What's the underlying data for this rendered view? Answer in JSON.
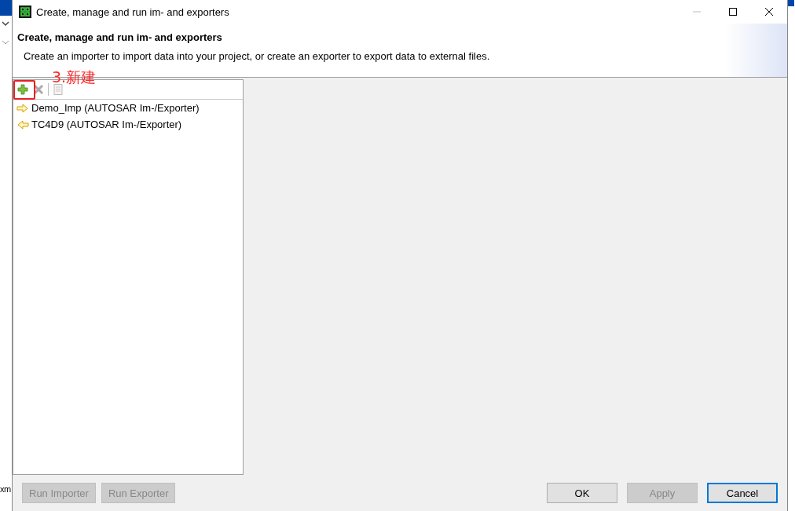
{
  "background": {
    "fragment": "xm"
  },
  "window": {
    "title": "Create, manage and run im- and exporters"
  },
  "header": {
    "title": "Create, manage and run im- and exporters",
    "description": "Create an importer to import data into your project, or create an exporter to export data to external files."
  },
  "toolbar": [
    {
      "kind": "add",
      "disabled": false,
      "highlighted": true
    },
    {
      "kind": "delete",
      "disabled": true,
      "highlighted": false
    },
    {
      "kind": "copy",
      "disabled": true,
      "highlighted": false
    }
  ],
  "annotation": {
    "text": "3.新建"
  },
  "list": [
    {
      "kind": "outgoing",
      "label": "Demo_Imp (AUTOSAR Im-/Exporter)"
    },
    {
      "kind": "incoming",
      "label": "TC4D9 (AUTOSAR Im-/Exporter)"
    }
  ],
  "left_buttons": [
    {
      "label": "Run Importer",
      "disabled": true
    },
    {
      "label": "Run Exporter",
      "disabled": true
    }
  ],
  "right_buttons": [
    {
      "label": "OK",
      "disabled": false,
      "focused": false
    },
    {
      "label": "Apply",
      "disabled": true,
      "focused": false
    },
    {
      "label": "Cancel",
      "disabled": false,
      "focused": true
    }
  ]
}
